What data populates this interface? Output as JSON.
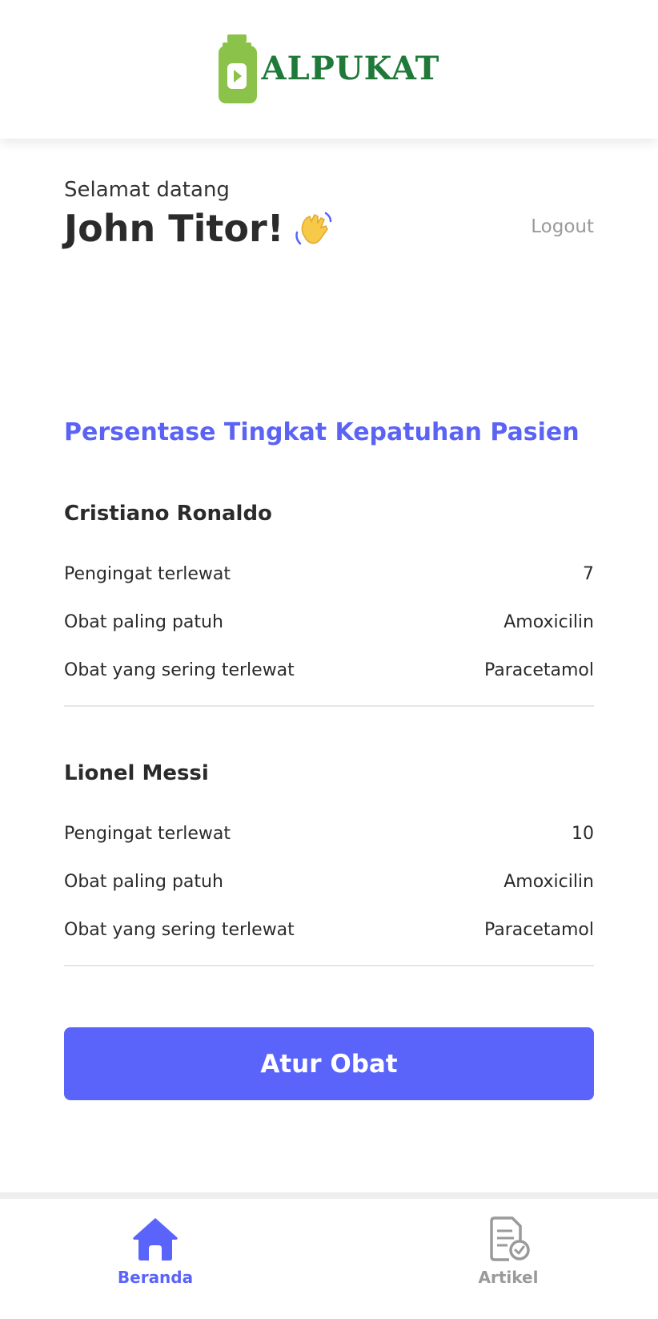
{
  "header": {
    "brand": "ALPUKAT"
  },
  "welcome": {
    "greeting": "Selamat datang",
    "name": "John Titor!"
  },
  "logout_label": "Logout",
  "section_title": "Persentase Tingkat Kepatuhan Pasien",
  "patients": [
    {
      "name": "Cristiano Ronaldo",
      "rows": [
        {
          "label": "Pengingat terlewat",
          "value": "7"
        },
        {
          "label": "Obat paling patuh",
          "value": "Amoxicilin"
        },
        {
          "label": "Obat yang sering terlewat",
          "value": "Paracetamol"
        }
      ]
    },
    {
      "name": "Lionel Messi",
      "rows": [
        {
          "label": "Pengingat terlewat",
          "value": "10"
        },
        {
          "label": "Obat paling patuh",
          "value": "Amoxicilin"
        },
        {
          "label": "Obat yang sering terlewat",
          "value": "Paracetamol"
        }
      ]
    }
  ],
  "primary_button": "Atur Obat",
  "nav": [
    {
      "label": "Beranda",
      "icon": "home-icon",
      "active": true
    },
    {
      "label": "Artikel",
      "icon": "article-icon",
      "active": false
    }
  ],
  "colors": {
    "accent": "#5a64fb",
    "brand_green": "#1f7a3a",
    "logo_green": "#8bc34a"
  }
}
